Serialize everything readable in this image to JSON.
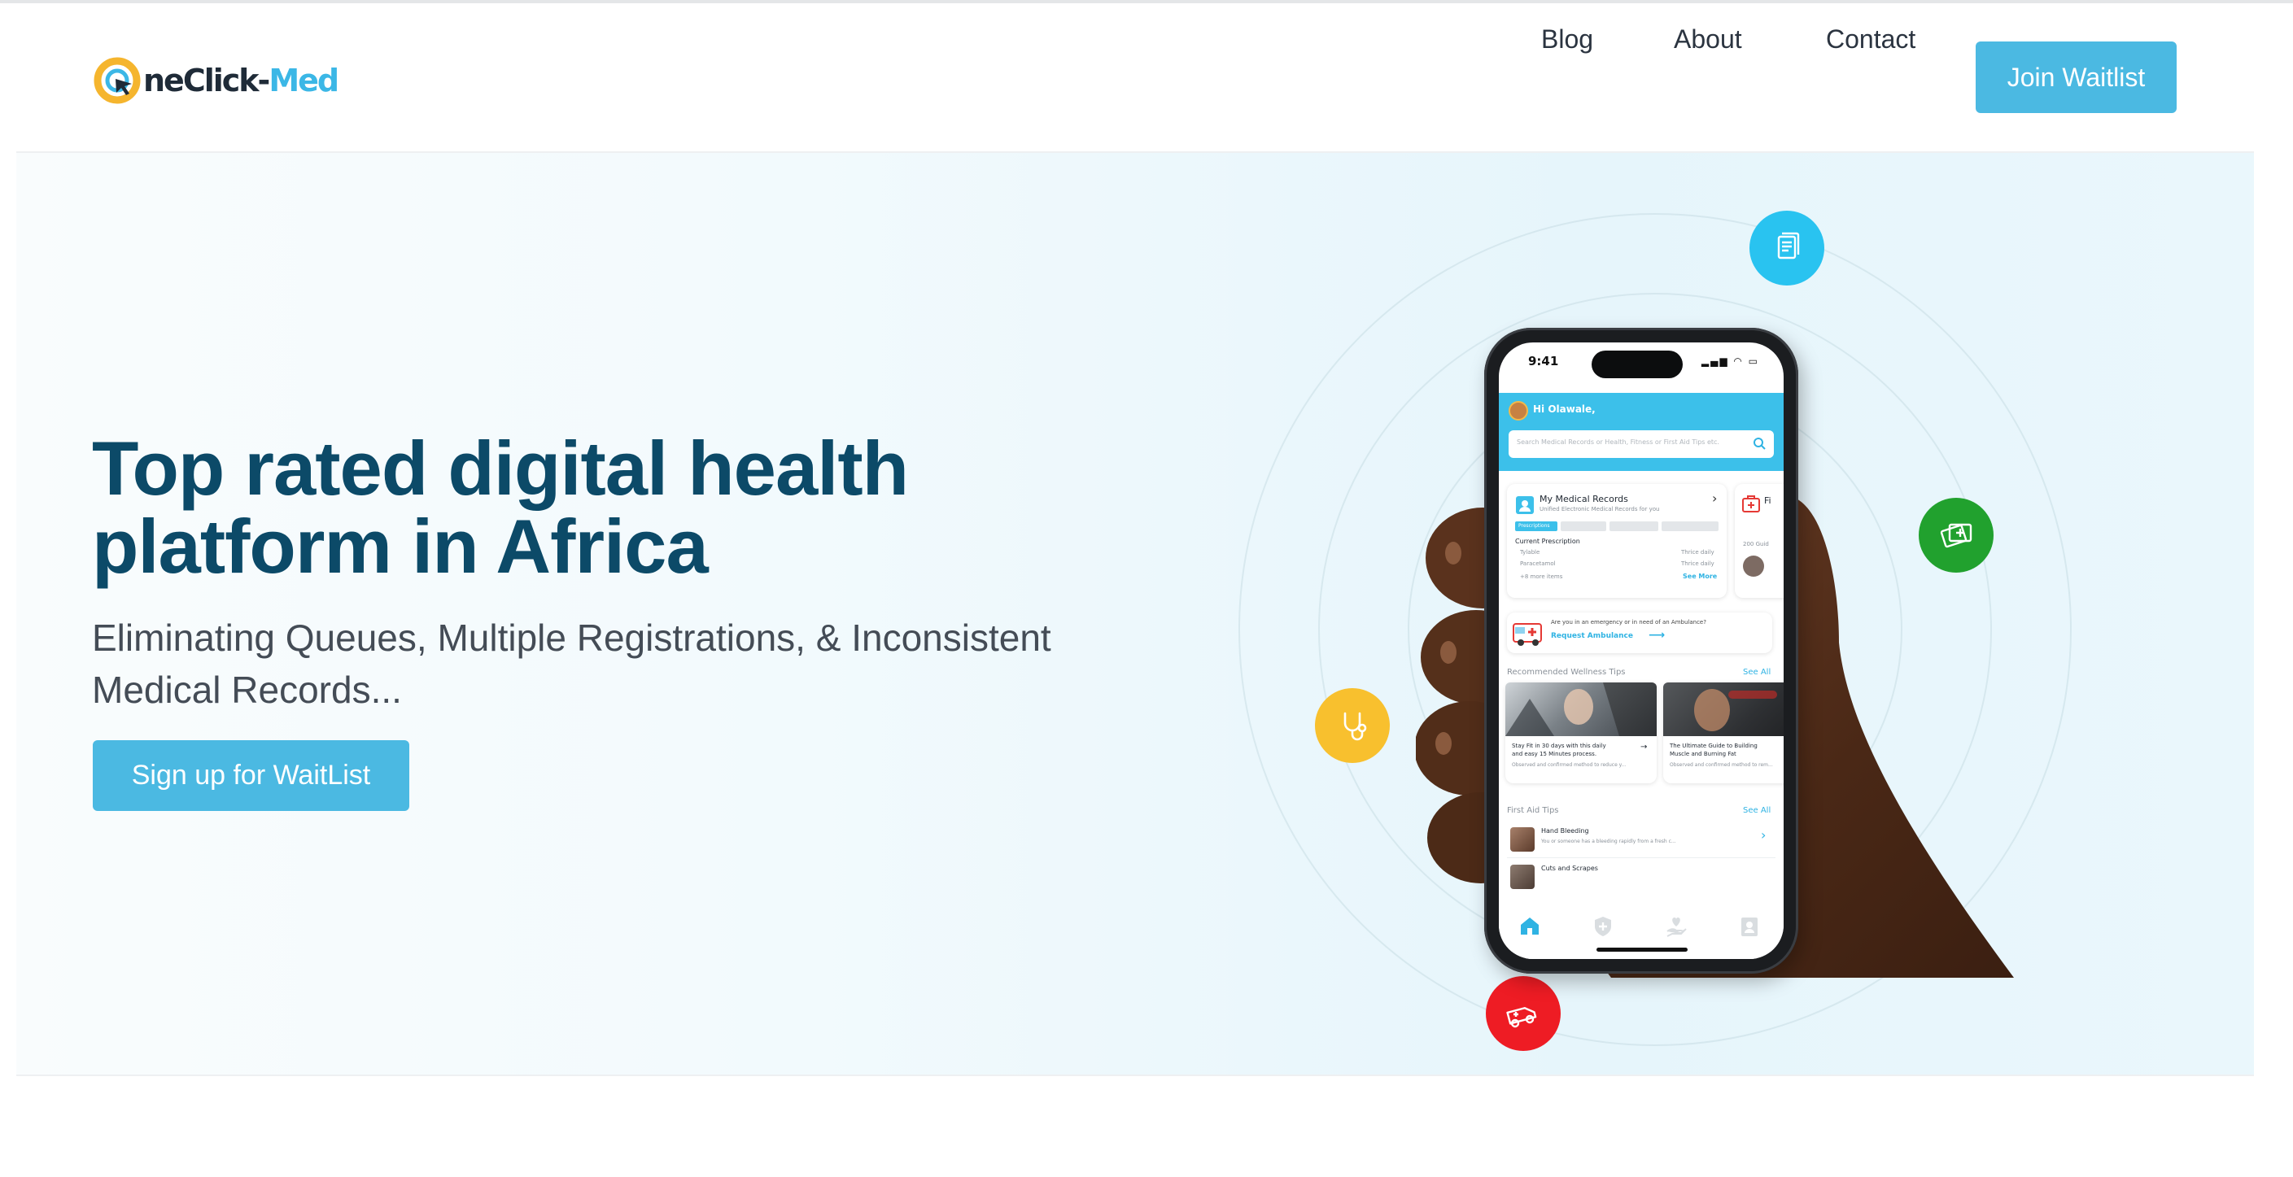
{
  "brand": {
    "logo_part1": "neClick-",
    "logo_part2": "Med",
    "colors": {
      "primary": "#4bb9e2",
      "headline": "#0c4a68",
      "logo_dark": "#1f2b38",
      "logo_accent": "#3bb7e6",
      "logo_ring": "#f5b52e"
    }
  },
  "nav": {
    "links": [
      "Blog",
      "About",
      "Contact"
    ],
    "cta": "Join Waitlist"
  },
  "hero": {
    "headline_line1": "Top rated digital health",
    "headline_line2": "platform in Africa",
    "subhead_line1": "Eliminating Queues, Multiple Registrations, & Inconsistent",
    "subhead_line2": "Medical Records...",
    "cta": "Sign up for WaitList"
  },
  "floating_icons": [
    {
      "name": "documents-icon",
      "color": "#29c3f0"
    },
    {
      "name": "health-card-icon",
      "color": "#21a12e"
    },
    {
      "name": "stethoscope-icon",
      "color": "#f8c02e"
    },
    {
      "name": "ambulance-icon",
      "color": "#ee1c24"
    }
  ],
  "phone": {
    "time": "9:41",
    "greeting": "Hi Olawale,",
    "search_placeholder": "Search Medical Records or Health, Fitness or First Aid Tips etc.",
    "records_card": {
      "title": "My Medical Records",
      "subtitle": "Unified Electronic Medical Records for you",
      "active_tab": "Prescriptions",
      "section": "Current Prescription",
      "rows": [
        {
          "drug": "Tylable",
          "dose": "Thrice daily"
        },
        {
          "drug": "Paracetamol",
          "dose": "Thrice daily"
        }
      ],
      "more": "+8 more items",
      "see_more": "See More"
    },
    "side_card": {
      "title": "Fi",
      "count": "200 Guid"
    },
    "ambulance": {
      "question": "Are you in an emergency or in need of an Ambulance?",
      "action": "Request Ambulance"
    },
    "wellness": {
      "title": "Recommended Wellness Tips",
      "see_all": "See All",
      "tips": [
        {
          "title1": "Stay Fit in 30 days with this daily",
          "title2": "and easy 15 Minutes process.",
          "desc": "Observed and confirmed method to reduce y..."
        },
        {
          "title1": "The Ultimate Guide to Building",
          "title2": "Muscle and Burning Fat",
          "desc": "Observed and confirmed method to rem..."
        }
      ]
    },
    "first_aid": {
      "title": "First Aid Tips",
      "see_all": "See All",
      "items": [
        {
          "title": "Hand Bleeding",
          "desc": "You or someone has a bleeding rapidly from a fresh c..."
        },
        {
          "title": "Cuts and Scrapes",
          "desc": ""
        }
      ]
    },
    "tabbar_icons": [
      "home-icon",
      "shield-plus-icon",
      "heart-hand-icon",
      "profile-card-icon"
    ]
  }
}
